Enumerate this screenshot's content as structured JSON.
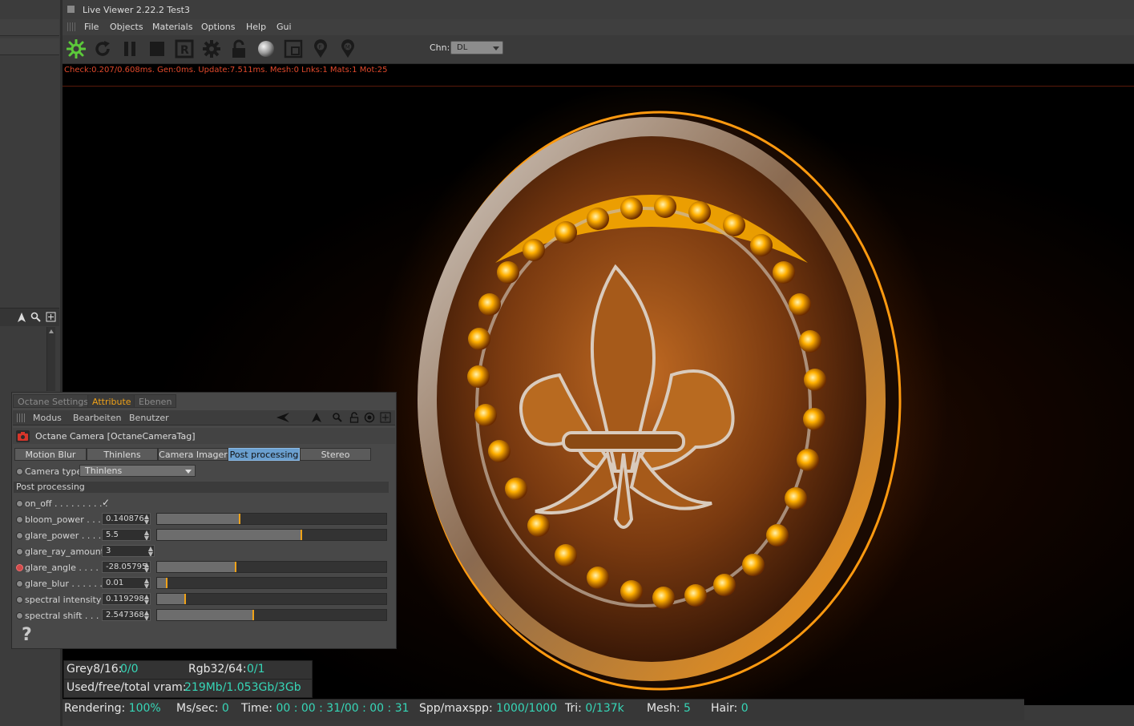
{
  "window": {
    "title": "Live Viewer 2.22.2 Test3"
  },
  "menu": [
    "File",
    "Objects",
    "Materials",
    "Options",
    "Help",
    "Gui"
  ],
  "toolbar": {
    "icons": [
      "octane-logo-icon",
      "refresh-icon",
      "pause-icon",
      "stop-icon",
      "reset-icon",
      "settings-gear-icon",
      "lock-icon",
      "material-sphere-icon",
      "region-icon",
      "focus-pin-icon",
      "material-pin-icon"
    ],
    "chn_label": "Chn:",
    "chn_value": "DL"
  },
  "status_text": "Check:0.207/0.608ms. Gen:0ms. Update:7.511ms. Mesh:0 Lnks:1 Mats:1 Mot:25",
  "panel": {
    "tabs": [
      "Octane Settings",
      "Attribute",
      "Ebenen"
    ],
    "active_tab": "Attribute",
    "menu": [
      "Modus",
      "Bearbeiten",
      "Benutzer"
    ],
    "object_title": "Octane Camera [OctaneCameraTag]",
    "subtabs": [
      "Motion Blur",
      "Thinlens",
      "Camera Imager",
      "Post processing",
      "Stereo"
    ],
    "active_subtab": "Post processing",
    "camera_type_label": "Camera type",
    "camera_type_value": "Thinlens",
    "section_title": "Post processing",
    "params": [
      {
        "label": "on_off . . . . . . . . . .",
        "value": "✓"
      },
      {
        "label": "bloom_power . . .",
        "value": "0.140876",
        "slider": 0.36
      },
      {
        "label": "glare_power . . . .",
        "value": "5.5",
        "slider": 0.63
      },
      {
        "label": "glare_ray_amount",
        "value": "3"
      },
      {
        "label": "glare_angle . . . . .",
        "value": "-28.05795",
        "slider": 0.34
      },
      {
        "label": "glare_blur . . . . . .",
        "value": "0.01",
        "slider": 0.04
      },
      {
        "label": "spectral intensity",
        "value": "0.119298",
        "slider": 0.12
      },
      {
        "label": "spectral shift . . . .",
        "value": "2.547368",
        "slider": 0.42
      }
    ],
    "help": "?"
  },
  "info": {
    "grey_label": "Grey8/16:",
    "grey_value": "0/0",
    "rgb_label": "Rgb32/64:",
    "rgb_value": "0/1",
    "vram_label": "Used/free/total vram:",
    "vram_value": "219Mb/1.053Gb/3Gb"
  },
  "bottom": {
    "rendering_label": "Rendering:",
    "rendering_value": "100%",
    "ms_label": "Ms/sec:",
    "ms_value": "0",
    "time_label": "Time:",
    "time_value": "00 : 00 : 31/00 : 00 : 31",
    "spp_label": "Spp/maxspp:",
    "spp_value": "1000/1000",
    "tri_label": "Tri:",
    "tri_value": "0/137k",
    "mesh_label": "Mesh:",
    "mesh_value": "5",
    "hair_label": "Hair:",
    "hair_value": "0"
  },
  "colors": {
    "accent_orange": "#f0a218",
    "status_red": "#e0492c",
    "value_teal": "#36d6b7",
    "tab_blue": "#6a9fcf"
  }
}
